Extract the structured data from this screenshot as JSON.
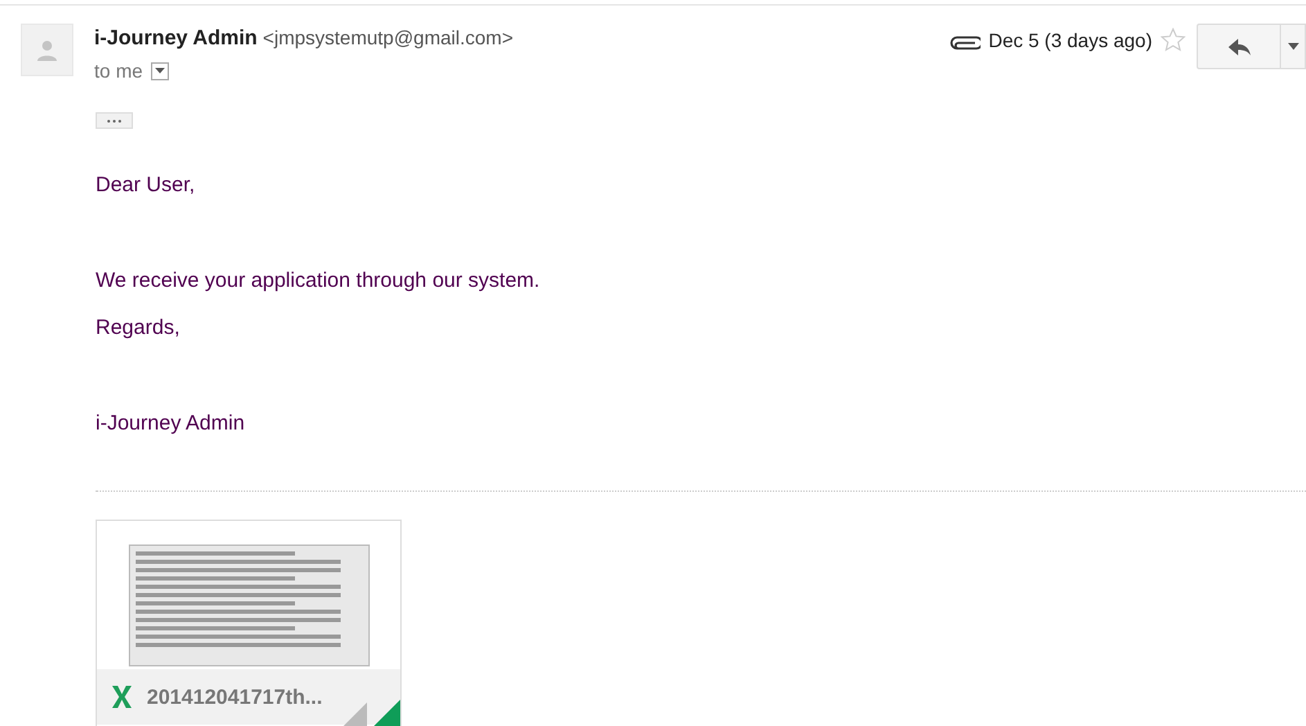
{
  "sender": {
    "name": "i-Journey Admin",
    "email": "<jmpsystemutp@gmail.com>"
  },
  "recipient": "to me",
  "date": "Dec 5 (3 days ago)",
  "starred": false,
  "body": [
    "Dear User,",
    "We receive your application through our system.",
    "Regards,",
    "i-Journey Admin"
  ],
  "attachment": {
    "name": "201412041717th..."
  }
}
